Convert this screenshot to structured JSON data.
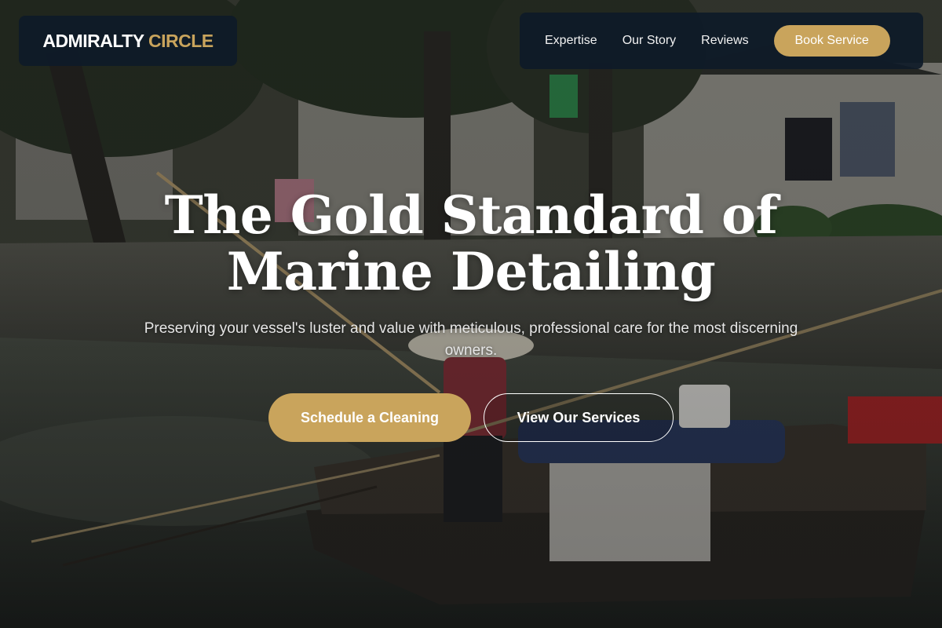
{
  "brand": {
    "name_main": "ADMIRALTY",
    "name_accent": "CIRCLE",
    "accent_color": "#c9a45c",
    "panel_color": "#0e1a28"
  },
  "nav": {
    "links": [
      "Expertise",
      "Our Story",
      "Reviews"
    ],
    "cta_label": "Book Service"
  },
  "hero": {
    "headline_line1": "The Gold Standard of",
    "headline_line2": "Marine Detailing",
    "subheadline": "Preserving your vessel's luster and value with meticulous, professional care for the most discerning owners.",
    "primary_button": "Schedule a Cleaning",
    "secondary_button": "View Our Services",
    "background_image": "canal with houses, trees and a person on a wooden boat"
  }
}
